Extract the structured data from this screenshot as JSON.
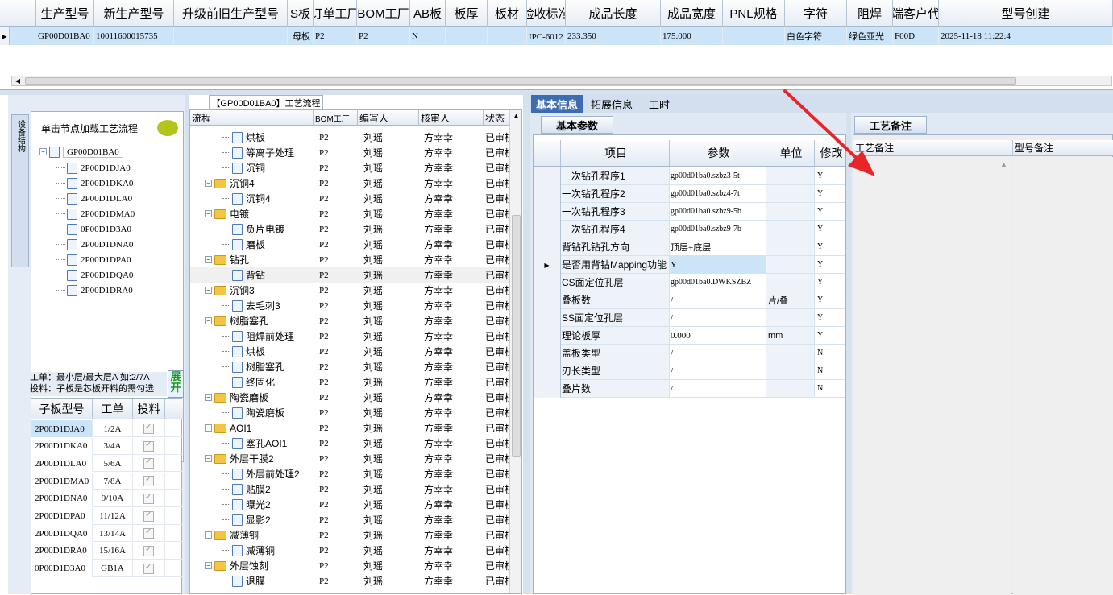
{
  "top_grid": {
    "columns": [
      "生产型号",
      "新生产型号",
      "升级前旧生产型号",
      "S板",
      "订单工厂",
      "BOM工厂",
      "AB板",
      "板厚",
      "板材",
      "验收标准",
      "成品长度",
      "成品宽度",
      "PNL规格",
      "字符",
      "阻焊",
      "终端客户代码",
      "型号创建"
    ],
    "row": [
      "GP00D01BA0",
      "10011600015735",
      "",
      "母板",
      "P2",
      "P2",
      "N",
      "",
      "",
      "IPC-6012 II级",
      "233.350",
      "175.000",
      "",
      "白色字符",
      "绿色亚光",
      "F00D",
      "2025-11-18 11:22:4"
    ]
  },
  "left_panel": {
    "side_tab": "设备结构",
    "load_prompt": "单击节点加载工艺流程",
    "tree_root": "GP00D01BA0",
    "tree_children": [
      "2P00D1DJA0",
      "2P00D1DKA0",
      "2P00D1DLA0",
      "2P00D1DMA0",
      "0P00D1D3A0",
      "2P00D1DNA0",
      "2P00D1DPA0",
      "2P00D1DQA0",
      "2P00D1DRA0"
    ],
    "hint_line1": "工单：最小层/最大层A 如:2/7A",
    "hint_line2": "投料：子板是芯板开料的需勾选",
    "expand_button": "展开",
    "sub_headers": [
      "子板型号",
      "工单",
      "投料"
    ],
    "sub_rows": [
      {
        "model": "2P00D1DJA0",
        "order": "1/2A",
        "checked": true
      },
      {
        "model": "2P00D1DKA0",
        "order": "3/4A",
        "checked": true
      },
      {
        "model": "2P00D1DLA0",
        "order": "5/6A",
        "checked": true
      },
      {
        "model": "2P00D1DMA0",
        "order": "7/8A",
        "checked": true
      },
      {
        "model": "2P00D1DNA0",
        "order": "9/10A",
        "checked": true
      },
      {
        "model": "2P00D1DPA0",
        "order": "11/12A",
        "checked": true
      },
      {
        "model": "2P00D1DQA0",
        "order": "13/14A",
        "checked": true
      },
      {
        "model": "2P00D1DRA0",
        "order": "15/16A",
        "checked": true
      },
      {
        "model": "0P00D1D3A0",
        "order": "GB1A",
        "checked": true
      }
    ]
  },
  "process": {
    "title": "【GP00D01BA0】工艺流程",
    "headers": [
      "流程",
      "BOM工厂",
      "编写人",
      "核审人",
      "状态"
    ],
    "rows": [
      {
        "name": "烘板",
        "type": "doc",
        "bom": "P2",
        "writer": "刘瑶",
        "reviewer": "方幸幸",
        "status": "已审核"
      },
      {
        "name": "等离子处理",
        "type": "doc",
        "bom": "P2",
        "writer": "刘瑶",
        "reviewer": "方幸幸",
        "status": "已审核"
      },
      {
        "name": "沉铜",
        "type": "doc",
        "bom": "P2",
        "writer": "刘瑶",
        "reviewer": "方幸幸",
        "status": "已审核"
      },
      {
        "name": "沉铜4",
        "type": "folder",
        "bom": "P2",
        "writer": "刘瑶",
        "reviewer": "方幸幸",
        "status": "已审核"
      },
      {
        "name": "沉铜4",
        "type": "doc",
        "bom": "P2",
        "writer": "刘瑶",
        "reviewer": "方幸幸",
        "status": "已审核"
      },
      {
        "name": "电镀",
        "type": "folder",
        "bom": "P2",
        "writer": "刘瑶",
        "reviewer": "方幸幸",
        "status": "已审核"
      },
      {
        "name": "负片电镀",
        "type": "doc",
        "bom": "P2",
        "writer": "刘瑶",
        "reviewer": "方幸幸",
        "status": "已审核"
      },
      {
        "name": "磨板",
        "type": "doc",
        "bom": "P2",
        "writer": "刘瑶",
        "reviewer": "方幸幸",
        "status": "已审核"
      },
      {
        "name": "钻孔",
        "type": "folder",
        "bom": "P2",
        "writer": "刘瑶",
        "reviewer": "方幸幸",
        "status": "已审核"
      },
      {
        "name": "背钻",
        "type": "doc",
        "bom": "P2",
        "writer": "刘瑶",
        "reviewer": "方幸幸",
        "status": "已审核"
      },
      {
        "name": "沉铜3",
        "type": "folder",
        "bom": "P2",
        "writer": "刘瑶",
        "reviewer": "方幸幸",
        "status": "已审核"
      },
      {
        "name": "去毛刺3",
        "type": "doc",
        "bom": "P2",
        "writer": "刘瑶",
        "reviewer": "方幸幸",
        "status": "已审核"
      },
      {
        "name": "树脂塞孔",
        "type": "folder",
        "bom": "P2",
        "writer": "刘瑶",
        "reviewer": "方幸幸",
        "status": "已审核"
      },
      {
        "name": "阻焊前处理",
        "type": "doc",
        "bom": "P2",
        "writer": "刘瑶",
        "reviewer": "方幸幸",
        "status": "已审核"
      },
      {
        "name": "烘板",
        "type": "doc",
        "bom": "P2",
        "writer": "刘瑶",
        "reviewer": "方幸幸",
        "status": "已审核"
      },
      {
        "name": "树脂塞孔",
        "type": "doc",
        "bom": "P2",
        "writer": "刘瑶",
        "reviewer": "方幸幸",
        "status": "已审核"
      },
      {
        "name": "终固化",
        "type": "doc",
        "bom": "P2",
        "writer": "刘瑶",
        "reviewer": "方幸幸",
        "status": "已审核"
      },
      {
        "name": "陶瓷磨板",
        "type": "folder",
        "bom": "P2",
        "writer": "刘瑶",
        "reviewer": "方幸幸",
        "status": "已审核"
      },
      {
        "name": "陶瓷磨板",
        "type": "doc",
        "bom": "P2",
        "writer": "刘瑶",
        "reviewer": "方幸幸",
        "status": "已审核"
      },
      {
        "name": "AOI1",
        "type": "folder",
        "bom": "P2",
        "writer": "刘瑶",
        "reviewer": "方幸幸",
        "status": "已审核"
      },
      {
        "name": "塞孔AOI1",
        "type": "doc",
        "bom": "P2",
        "writer": "刘瑶",
        "reviewer": "方幸幸",
        "status": "已审核"
      },
      {
        "name": "外层干膜2",
        "type": "folder",
        "bom": "P2",
        "writer": "刘瑶",
        "reviewer": "方幸幸",
        "status": "已审核"
      },
      {
        "name": "外层前处理2",
        "type": "doc",
        "bom": "P2",
        "writer": "刘瑶",
        "reviewer": "方幸幸",
        "status": "已审核"
      },
      {
        "name": "贴膜2",
        "type": "doc",
        "bom": "P2",
        "writer": "刘瑶",
        "reviewer": "方幸幸",
        "status": "已审核"
      },
      {
        "name": "曝光2",
        "type": "doc",
        "bom": "P2",
        "writer": "刘瑶",
        "reviewer": "方幸幸",
        "status": "已审核"
      },
      {
        "name": "显影2",
        "type": "doc",
        "bom": "P2",
        "writer": "刘瑶",
        "reviewer": "方幸幸",
        "status": "已审核"
      },
      {
        "name": "减薄铜",
        "type": "folder",
        "bom": "P2",
        "writer": "刘瑶",
        "reviewer": "方幸幸",
        "status": "已审核"
      },
      {
        "name": "减薄铜",
        "type": "doc",
        "bom": "P2",
        "writer": "刘瑶",
        "reviewer": "方幸幸",
        "status": "已审核"
      },
      {
        "name": "外层蚀刻",
        "type": "folder",
        "bom": "P2",
        "writer": "刘瑶",
        "reviewer": "方幸幸",
        "status": "已审核"
      },
      {
        "name": "退膜",
        "type": "doc",
        "bom": "P2",
        "writer": "刘瑶",
        "reviewer": "方幸幸",
        "status": "已审核"
      }
    ]
  },
  "right_tabs": [
    "基本信息",
    "拓展信息",
    "工时"
  ],
  "basic": {
    "group_tab": "基本参数",
    "headers": [
      "项目",
      "参数",
      "单位",
      "修改"
    ],
    "rows": [
      {
        "item": "一次钻孔程序1",
        "param": "gp00d01ba0.szbz3-5t",
        "unit": "",
        "edit": "Y"
      },
      {
        "item": "一次钻孔程序2",
        "param": "gp00d01ba0.szbz4-7t",
        "unit": "",
        "edit": "Y"
      },
      {
        "item": "一次钻孔程序3",
        "param": "gp00d01ba0.szbz9-5b",
        "unit": "",
        "edit": "Y"
      },
      {
        "item": "一次钻孔程序4",
        "param": "gp00d01ba0.szbz9-7b",
        "unit": "",
        "edit": "Y"
      },
      {
        "item": "背钻孔钻孔方向",
        "param": "顶层+底层",
        "unit": "",
        "edit": "Y"
      },
      {
        "item": "是否用背钻Mapping功能",
        "param": "Y",
        "unit": "",
        "edit": "Y"
      },
      {
        "item": "CS面定位孔层",
        "param": "gp00d01ba0.DWKSZBZ",
        "unit": "",
        "edit": "Y"
      },
      {
        "item": "叠板数",
        "param": "/",
        "unit": "片/叠",
        "edit": "Y"
      },
      {
        "item": "SS面定位孔层",
        "param": "/",
        "unit": "",
        "edit": "Y"
      },
      {
        "item": "理论板厚",
        "param": "0.000",
        "unit": "mm",
        "edit": "Y"
      },
      {
        "item": "盖板类型",
        "param": "/",
        "unit": "",
        "edit": "N"
      },
      {
        "item": "刃长类型",
        "param": "/",
        "unit": "",
        "edit": "N"
      },
      {
        "item": "叠片数",
        "param": "/",
        "unit": "",
        "edit": "N"
      }
    ]
  },
  "notes": {
    "tab": "工艺备注",
    "col1": "工艺备注",
    "col2": "型号备注"
  },
  "colors": {
    "accent": "#3d6cb1",
    "selected_row": "#cce4f7",
    "arrow": "#e8262a"
  }
}
